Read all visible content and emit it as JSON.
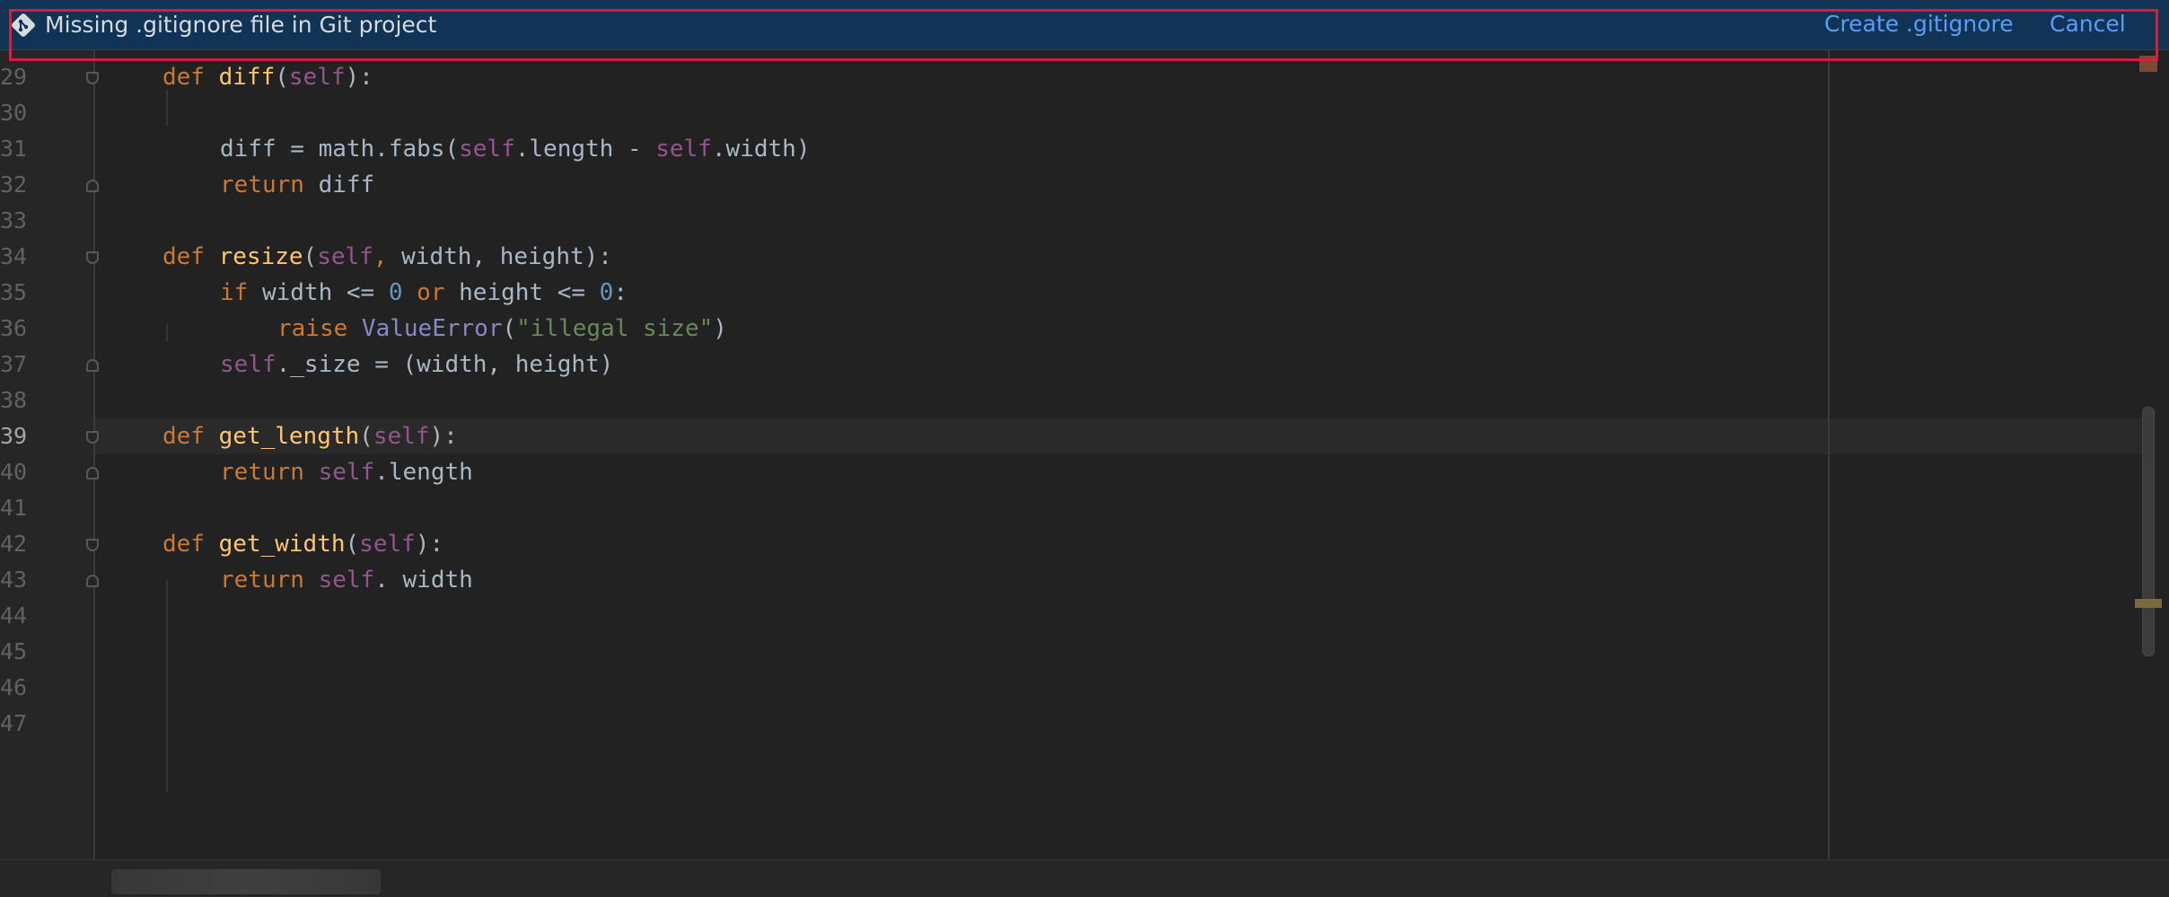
{
  "banner": {
    "message": "Missing .gitignore file in Git project",
    "icon": "git-icon",
    "create_label": "Create .gitignore",
    "cancel_label": "Cancel"
  },
  "editor": {
    "current_line": "39",
    "lines": [
      {
        "n": "29"
      },
      {
        "n": "30"
      },
      {
        "n": "31"
      },
      {
        "n": "32"
      },
      {
        "n": "33"
      },
      {
        "n": "34"
      },
      {
        "n": "35"
      },
      {
        "n": "36"
      },
      {
        "n": "37"
      },
      {
        "n": "38"
      },
      {
        "n": "39"
      },
      {
        "n": "40"
      },
      {
        "n": "41"
      },
      {
        "n": "42"
      },
      {
        "n": "43"
      },
      {
        "n": "44"
      },
      {
        "n": "45"
      },
      {
        "n": "46"
      },
      {
        "n": "47"
      }
    ],
    "code": {
      "l29": {
        "kw": "def",
        "fn": "diff",
        "p1": "(",
        "slf": "self",
        "p2": "):"
      },
      "l31": {
        "a": "diff = math.fabs(",
        "slf1": "self",
        ".b": ".length - ",
        "slf2": "self",
        "c": ".width)"
      },
      "l32": {
        "kw": "return",
        "rest": " diff"
      },
      "l34": {
        "kw": "def",
        "fn": "resize",
        "p1": "(",
        "slf": "self",
        "comma": ",",
        "rest": " width, height):"
      },
      "l35": {
        "kw": "if",
        "a": " width <= ",
        "n1": "0",
        "kw2": " or",
        "b": " height <= ",
        "n2": "0",
        "c": ":"
      },
      "l36": {
        "kw": "raise",
        "cls": " ValueError",
        "p": "(",
        "str": "\"illegal size\"",
        "e": ")"
      },
      "l37": {
        "slf": "self",
        "rest": "._size = (width, height)"
      },
      "l39": {
        "kw": "def",
        "fn": "get_length",
        "p1": "(",
        "slf": "self",
        "p2": "):"
      },
      "l40": {
        "kw": "return",
        "slf": " self",
        "rest": ".length"
      },
      "l42": {
        "kw": "def",
        "fn": "get_width",
        "p1": "(",
        "slf": "self",
        "p2": "):"
      },
      "l43": {
        "kw": "return",
        "slf": " self",
        "rest": ". width"
      }
    }
  },
  "colors": {
    "banner_bg": "#113355",
    "link": "#589df6",
    "keyword": "#cc7832",
    "function": "#ffc66d",
    "self": "#94558d",
    "number": "#6897bb",
    "string": "#6a8759"
  }
}
